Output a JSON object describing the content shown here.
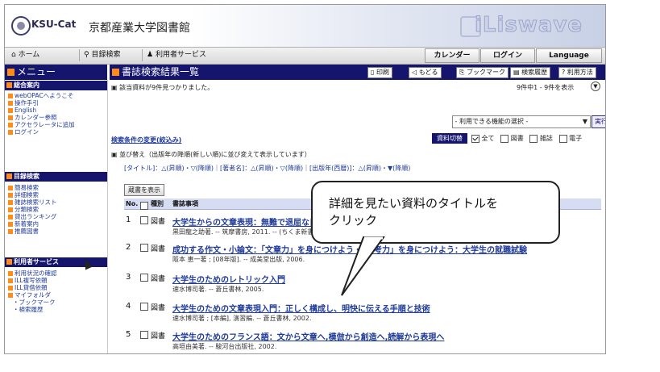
{
  "header": {
    "logo_text": "KSU-Cat",
    "library_name": "京都産業大学図書館",
    "brand": "iLiswave"
  },
  "nav": {
    "home": "ホーム",
    "catalog_search": "目録検索",
    "user_service": "利用者サービス",
    "calendar": "カレンダー",
    "login": "ログイン",
    "language": "Language"
  },
  "menu": {
    "title": "メニュー",
    "general": {
      "heading": "総合案内",
      "items": [
        "webOPACへようこそ",
        "操作手引",
        "English",
        "カレンダー参照",
        "アクセラレータに追加",
        "ログイン"
      ]
    },
    "catalog": {
      "heading": "目録検索",
      "items": [
        "簡易検索",
        "詳細検索",
        "雑誌検索リスト",
        "分類検索",
        "貸出ランキング",
        "新着案内",
        "推薦図書"
      ]
    },
    "user": {
      "heading": "利用者サービス",
      "items": [
        "利用状況の確認",
        "ILL複写依頼",
        "ILL貸借依頼",
        "マイフォルダ"
      ],
      "subitems": [
        "ブックマーク",
        "検索履歴"
      ]
    }
  },
  "main": {
    "title": "書誌検索結果一覧",
    "toolbar": {
      "print": "印刷",
      "back": "もどる",
      "bookmark": "ブックマーク",
      "history": "検索履歴",
      "help": "利用方法"
    },
    "found_msg": "該当資料が9件見つかりました。",
    "count_msg": "9件中1 - 9件を表示",
    "select_placeholder": "- 利用できる機能の選択 -",
    "exec": "実行",
    "change_cond": "検索条件の変更(絞込み)",
    "switch_btn": "資料切替",
    "filters": {
      "all": "全て",
      "book": "図書",
      "journal": "雑誌",
      "electronic": "電子"
    },
    "sort_msg": "並び替え（出版年の降順(新しい順)に並び変えて表示しています）",
    "sort_line": "[タイトル]：△(昇順)・▽(降順)｜[著者名]：△(昇順)・▽(降順)｜[出版年(西暦)]：△(昇順)・▼(降順)",
    "display_btn": "蔵書を表示",
    "columns": {
      "no": "No.",
      "type": "種別",
      "info": "書誌事項"
    },
    "rows": [
      {
        "no": "1",
        "type": "図書",
        "title": "大学生からの文章表現：無難で退屈な日本語から卒業する",
        "author": "黒田龍之助著. -- 筑摩書房, 2011. -- (ちくま新書; 910)"
      },
      {
        "no": "2",
        "type": "図書",
        "title": "成功する作文・小論文：「文章力」を身につけよう・「思考力」を身につけよう：大学生の就職試験",
        "author": "阪本 恵一著 ; [08年版]. -- 成美堂出版, 2006."
      },
      {
        "no": "3",
        "type": "図書",
        "title": "大学生のためのレトリック入門",
        "author": "速水博司著. -- 蒼丘書林, 2005."
      },
      {
        "no": "4",
        "type": "図書",
        "title": "大学生のための文章表現入門：正しく構成し、明快に伝える手順と技術",
        "author": "速水博司著 ; [本編], 演習編. -- 蒼丘書林, 2002."
      },
      {
        "no": "5",
        "type": "図書",
        "title": "大学生のためのフランス語：文から文章へ,模倣から創造へ,読解から表現へ",
        "author": "高垣由美著. -- 駿河台出版社, 2002."
      }
    ]
  },
  "callout": {
    "line1": "詳細を見たい資料のタイトルを",
    "line2": "クリック"
  }
}
